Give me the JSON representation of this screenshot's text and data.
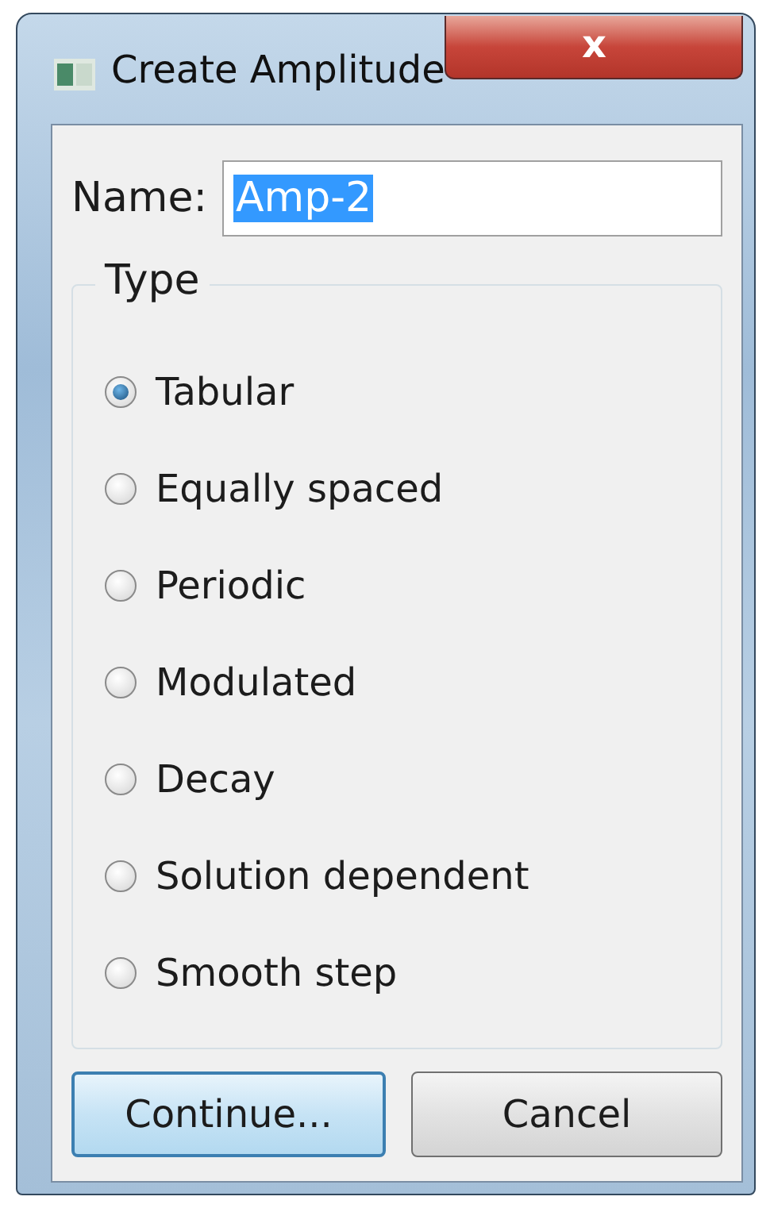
{
  "window": {
    "title": "Create Amplitude",
    "close": "x"
  },
  "name_field": {
    "label": "Name:",
    "value": "Amp-2",
    "value_selected": true
  },
  "type_group": {
    "title": "Type",
    "options": [
      {
        "label": "Tabular",
        "selected": true
      },
      {
        "label": "Equally spaced",
        "selected": false
      },
      {
        "label": "Periodic",
        "selected": false
      },
      {
        "label": "Modulated",
        "selected": false
      },
      {
        "label": "Decay",
        "selected": false
      },
      {
        "label": "Solution dependent",
        "selected": false
      },
      {
        "label": "Smooth step",
        "selected": false
      }
    ]
  },
  "buttons": [
    {
      "label": "Continue...",
      "default": true
    },
    {
      "label": "Cancel",
      "default": false
    }
  ]
}
